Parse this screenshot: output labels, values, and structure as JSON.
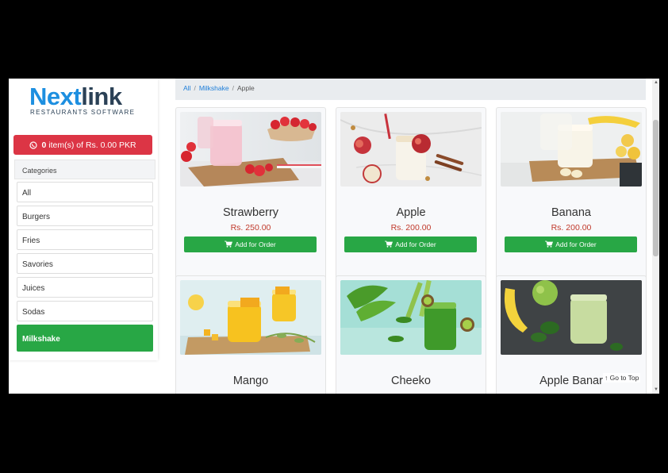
{
  "brand": {
    "name_part1": "Next",
    "name_part2": "link",
    "tagline": "RESTAURANTS SOFTWARE",
    "blue": "#1d8fe0",
    "navy": "#2b4156"
  },
  "cart": {
    "count": "0",
    "text": "item(s) of Rs. 0.00 PKR",
    "color": "#dc3545"
  },
  "categories": {
    "heading": "Categories",
    "items": [
      "All",
      "Burgers",
      "Fries",
      "Savories",
      "Juices",
      "Sodas",
      "Milkshake"
    ],
    "active": "Milkshake"
  },
  "breadcrumb": {
    "items": [
      "All",
      "Milkshake",
      "Apple"
    ],
    "separator": "/"
  },
  "products": [
    {
      "name": "Strawberry",
      "price": "Rs. 250.00",
      "button": "Add for Order"
    },
    {
      "name": "Apple",
      "price": "Rs. 200.00",
      "button": "Add for Order"
    },
    {
      "name": "Banana",
      "price": "Rs. 200.00",
      "button": "Add for Order"
    },
    {
      "name": "Mango",
      "price": "",
      "button": ""
    },
    {
      "name": "Cheeko",
      "price": "",
      "button": ""
    },
    {
      "name": "Apple Banar",
      "price": "",
      "button": ""
    }
  ],
  "go_to_top": "Go to Top",
  "colors": {
    "green": "#28a745",
    "price_red": "#c0392b",
    "link_blue": "#1e7ed9"
  }
}
